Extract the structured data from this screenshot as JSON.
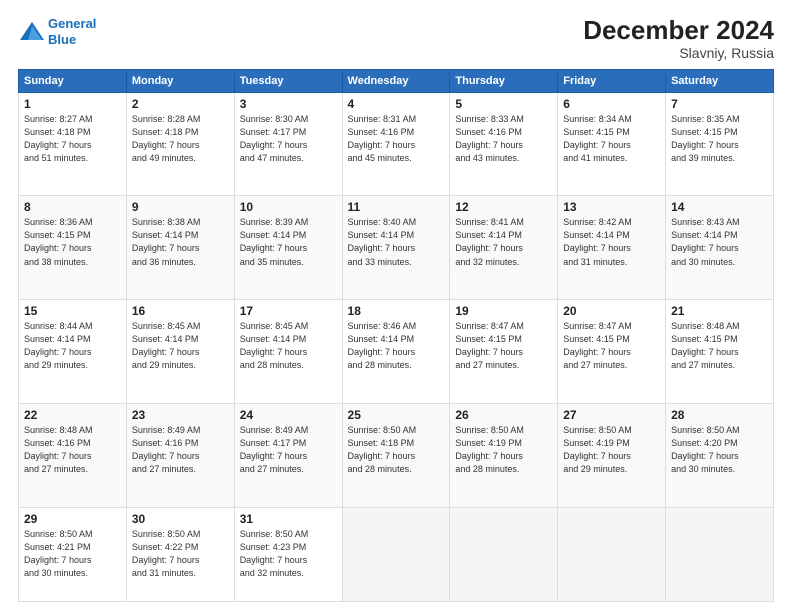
{
  "logo": {
    "line1": "General",
    "line2": "Blue"
  },
  "title": "December 2024",
  "subtitle": "Slavniy, Russia",
  "days_of_week": [
    "Sunday",
    "Monday",
    "Tuesday",
    "Wednesday",
    "Thursday",
    "Friday",
    "Saturday"
  ],
  "weeks": [
    [
      {
        "day": "1",
        "info": "Sunrise: 8:27 AM\nSunset: 4:18 PM\nDaylight: 7 hours\nand 51 minutes."
      },
      {
        "day": "2",
        "info": "Sunrise: 8:28 AM\nSunset: 4:18 PM\nDaylight: 7 hours\nand 49 minutes."
      },
      {
        "day": "3",
        "info": "Sunrise: 8:30 AM\nSunset: 4:17 PM\nDaylight: 7 hours\nand 47 minutes."
      },
      {
        "day": "4",
        "info": "Sunrise: 8:31 AM\nSunset: 4:16 PM\nDaylight: 7 hours\nand 45 minutes."
      },
      {
        "day": "5",
        "info": "Sunrise: 8:33 AM\nSunset: 4:16 PM\nDaylight: 7 hours\nand 43 minutes."
      },
      {
        "day": "6",
        "info": "Sunrise: 8:34 AM\nSunset: 4:15 PM\nDaylight: 7 hours\nand 41 minutes."
      },
      {
        "day": "7",
        "info": "Sunrise: 8:35 AM\nSunset: 4:15 PM\nDaylight: 7 hours\nand 39 minutes."
      }
    ],
    [
      {
        "day": "8",
        "info": "Sunrise: 8:36 AM\nSunset: 4:15 PM\nDaylight: 7 hours\nand 38 minutes."
      },
      {
        "day": "9",
        "info": "Sunrise: 8:38 AM\nSunset: 4:14 PM\nDaylight: 7 hours\nand 36 minutes."
      },
      {
        "day": "10",
        "info": "Sunrise: 8:39 AM\nSunset: 4:14 PM\nDaylight: 7 hours\nand 35 minutes."
      },
      {
        "day": "11",
        "info": "Sunrise: 8:40 AM\nSunset: 4:14 PM\nDaylight: 7 hours\nand 33 minutes."
      },
      {
        "day": "12",
        "info": "Sunrise: 8:41 AM\nSunset: 4:14 PM\nDaylight: 7 hours\nand 32 minutes."
      },
      {
        "day": "13",
        "info": "Sunrise: 8:42 AM\nSunset: 4:14 PM\nDaylight: 7 hours\nand 31 minutes."
      },
      {
        "day": "14",
        "info": "Sunrise: 8:43 AM\nSunset: 4:14 PM\nDaylight: 7 hours\nand 30 minutes."
      }
    ],
    [
      {
        "day": "15",
        "info": "Sunrise: 8:44 AM\nSunset: 4:14 PM\nDaylight: 7 hours\nand 29 minutes."
      },
      {
        "day": "16",
        "info": "Sunrise: 8:45 AM\nSunset: 4:14 PM\nDaylight: 7 hours\nand 29 minutes."
      },
      {
        "day": "17",
        "info": "Sunrise: 8:45 AM\nSunset: 4:14 PM\nDaylight: 7 hours\nand 28 minutes."
      },
      {
        "day": "18",
        "info": "Sunrise: 8:46 AM\nSunset: 4:14 PM\nDaylight: 7 hours\nand 28 minutes."
      },
      {
        "day": "19",
        "info": "Sunrise: 8:47 AM\nSunset: 4:15 PM\nDaylight: 7 hours\nand 27 minutes."
      },
      {
        "day": "20",
        "info": "Sunrise: 8:47 AM\nSunset: 4:15 PM\nDaylight: 7 hours\nand 27 minutes."
      },
      {
        "day": "21",
        "info": "Sunrise: 8:48 AM\nSunset: 4:15 PM\nDaylight: 7 hours\nand 27 minutes."
      }
    ],
    [
      {
        "day": "22",
        "info": "Sunrise: 8:48 AM\nSunset: 4:16 PM\nDaylight: 7 hours\nand 27 minutes."
      },
      {
        "day": "23",
        "info": "Sunrise: 8:49 AM\nSunset: 4:16 PM\nDaylight: 7 hours\nand 27 minutes."
      },
      {
        "day": "24",
        "info": "Sunrise: 8:49 AM\nSunset: 4:17 PM\nDaylight: 7 hours\nand 27 minutes."
      },
      {
        "day": "25",
        "info": "Sunrise: 8:50 AM\nSunset: 4:18 PM\nDaylight: 7 hours\nand 28 minutes."
      },
      {
        "day": "26",
        "info": "Sunrise: 8:50 AM\nSunset: 4:19 PM\nDaylight: 7 hours\nand 28 minutes."
      },
      {
        "day": "27",
        "info": "Sunrise: 8:50 AM\nSunset: 4:19 PM\nDaylight: 7 hours\nand 29 minutes."
      },
      {
        "day": "28",
        "info": "Sunrise: 8:50 AM\nSunset: 4:20 PM\nDaylight: 7 hours\nand 30 minutes."
      }
    ],
    [
      {
        "day": "29",
        "info": "Sunrise: 8:50 AM\nSunset: 4:21 PM\nDaylight: 7 hours\nand 30 minutes."
      },
      {
        "day": "30",
        "info": "Sunrise: 8:50 AM\nSunset: 4:22 PM\nDaylight: 7 hours\nand 31 minutes."
      },
      {
        "day": "31",
        "info": "Sunrise: 8:50 AM\nSunset: 4:23 PM\nDaylight: 7 hours\nand 32 minutes."
      },
      null,
      null,
      null,
      null
    ]
  ]
}
